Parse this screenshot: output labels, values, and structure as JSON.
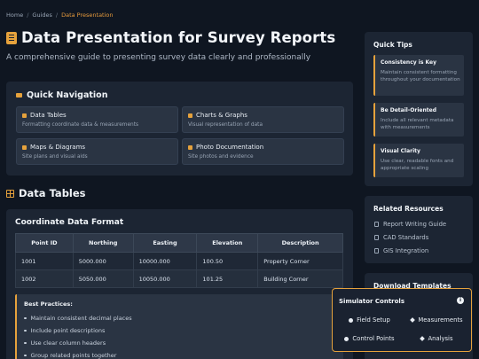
{
  "breadcrumb": {
    "home": "Home",
    "guides": "Guides",
    "current": "Data Presentation",
    "sep": "/"
  },
  "header": {
    "title": "Data Presentation for Survey Reports",
    "subtitle": "A comprehensive guide to presenting survey data clearly and professionally"
  },
  "quick_nav": {
    "title": "Quick Navigation",
    "items": [
      {
        "label": "Data Tables",
        "desc": "Formatting coordinate data & measurements"
      },
      {
        "label": "Charts & Graphs",
        "desc": "Visual representation of data"
      },
      {
        "label": "Maps & Diagrams",
        "desc": "Site plans and visual aids"
      },
      {
        "label": "Photo Documentation",
        "desc": "Site photos and evidence"
      }
    ]
  },
  "data_tables": {
    "title": "Data Tables",
    "subsection": "Coordinate Data Format",
    "columns": [
      "Point ID",
      "Northing",
      "Easting",
      "Elevation",
      "Description"
    ],
    "rows": [
      [
        "1001",
        "5000.000",
        "10000.000",
        "100.50",
        "Property Corner"
      ],
      [
        "1002",
        "5050.000",
        "10050.000",
        "101.25",
        "Building Corner"
      ]
    ],
    "best_practices": {
      "title": "Best Practices:",
      "items": [
        "Maintain consistent decimal places",
        "Include point descriptions",
        "Use clear column headers",
        "Group related points together"
      ]
    }
  },
  "quick_tips": {
    "title": "Quick Tips",
    "tips": [
      {
        "title": "Consistency is Key",
        "desc": "Maintain consistent formatting throughout your documentation"
      },
      {
        "title": "Be Detail-Oriented",
        "desc": "Include all relevant metadata with measurements"
      },
      {
        "title": "Visual Clarity",
        "desc": "Use clear, readable fonts and appropriate scaling"
      }
    ]
  },
  "related": {
    "title": "Related Resources",
    "links": [
      "Report Writing Guide",
      "CAD Standards",
      "GIS Integration"
    ]
  },
  "templates": {
    "title": "Download Templates"
  },
  "simulator": {
    "title": "Simulator Controls",
    "info": "i",
    "buttons": [
      "Field Setup",
      "Measurements",
      "Control Points",
      "Analysis"
    ]
  },
  "colors": {
    "accent": "#e6a23c",
    "background": "#0f1621",
    "panel": "#1c2533"
  }
}
